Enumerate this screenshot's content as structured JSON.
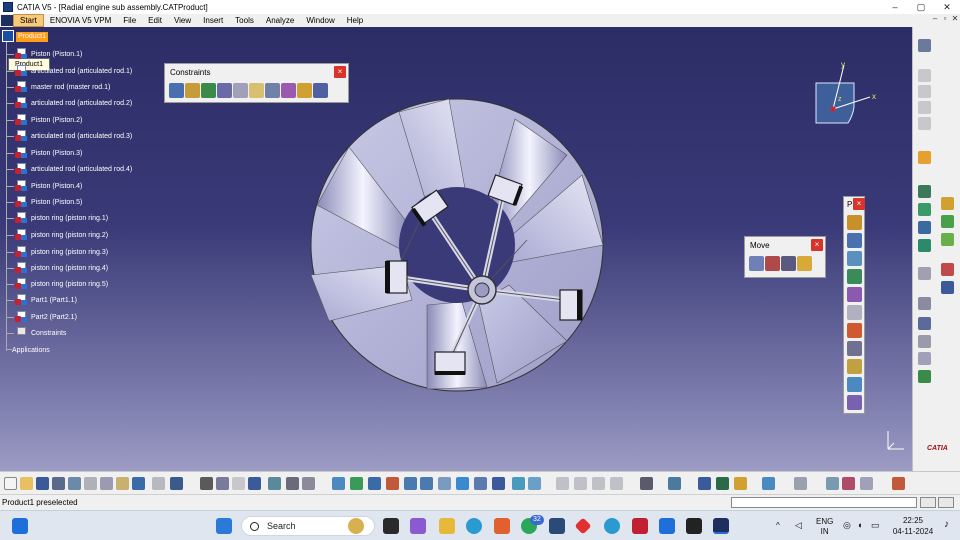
{
  "window": {
    "title": "CATIA V5 - [Radial engine sub assembly.CATProduct]",
    "controls": [
      "–",
      "▢",
      "✕"
    ]
  },
  "menubar": {
    "items": [
      "Start",
      "ENOVIA V5 VPM",
      "File",
      "Edit",
      "View",
      "Insert",
      "Tools",
      "Analyze",
      "Window",
      "Help"
    ],
    "mdi": [
      "–",
      "▫",
      "✕"
    ]
  },
  "tree": {
    "root": "Product1",
    "tooltip": "Product1",
    "items": [
      "Piston (Piston.1)",
      "articulated rod (articulated rod.1)",
      "master rod (master rod.1)",
      "articulated rod (articulated rod.2)",
      "Piston (Piston.2)",
      "articulated rod (articulated rod.3)",
      "Piston (Piston.3)",
      "articulated rod (articulated rod.4)",
      "Piston (Piston.4)",
      "Piston (Piston.5)",
      "piston ring (piston ring.1)",
      "piston ring (piston ring.2)",
      "piston ring (piston ring.3)",
      "piston ring (piston ring.4)",
      "piston ring (piston ring.5)",
      "Part1 (Part1.1)",
      "Part2 (Part2.1)",
      "Constraints"
    ],
    "applications": "Applications"
  },
  "panels": {
    "constraints": {
      "title": "Constraints",
      "close": "×"
    },
    "move": {
      "title": "Move",
      "close": "×"
    },
    "p": {
      "title": "P",
      "close": "×"
    }
  },
  "compass": {
    "x": "x",
    "y": "y",
    "z": "z"
  },
  "status": {
    "text": "Product1 preselected"
  },
  "taskbar": {
    "search": "Search",
    "badge": "32",
    "lang": "ENG",
    "region": "IN",
    "time": "22:25",
    "date": "04-11-2024"
  },
  "brand": {
    "catia": "CATIA"
  }
}
